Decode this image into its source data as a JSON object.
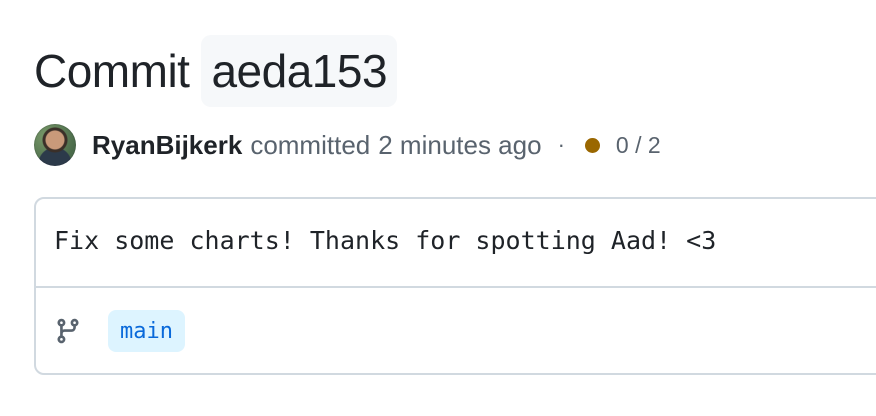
{
  "header": {
    "title_prefix": "Commit",
    "sha": "aeda153"
  },
  "meta": {
    "author": "RyanBijkerk",
    "action": "committed",
    "time": "2 minutes ago",
    "separator": "·",
    "checks": "0 / 2",
    "status_color": "#9a6700",
    "avatar_icon": "user-avatar"
  },
  "commit": {
    "message": "Fix some charts! Thanks for spotting Aad! <3",
    "branch_icon": "git-branch-icon",
    "branch": "main"
  }
}
